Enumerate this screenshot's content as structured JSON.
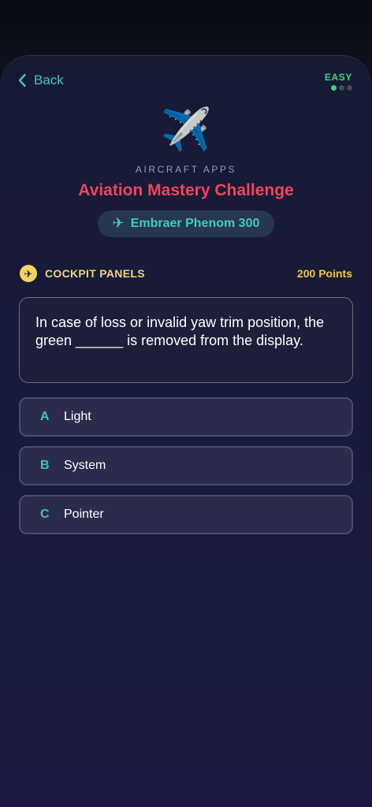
{
  "header": {
    "back_label": "Back",
    "difficulty": "EASY",
    "difficulty_level": 1,
    "difficulty_max": 3
  },
  "hero": {
    "icon": "✈️",
    "app_label": "AIRCRAFT APPS",
    "title": "Aviation Mastery Challenge",
    "aircraft_icon": "✈",
    "aircraft": "Embraer Phenom 300"
  },
  "category": {
    "icon": "✈",
    "label": "COCKPIT PANELS",
    "points": "200 Points"
  },
  "question": {
    "text": " In case of loss or invalid yaw trim position, the green ______ is removed from the display."
  },
  "options": [
    {
      "letter": "A",
      "text": "Light"
    },
    {
      "letter": "B",
      "text": "System"
    },
    {
      "letter": "C",
      "text": "Pointer"
    }
  ],
  "colors": {
    "accent": "#3fc9b8",
    "title": "#f2445e",
    "easy": "#3ed28a",
    "points": "#f5c832"
  }
}
